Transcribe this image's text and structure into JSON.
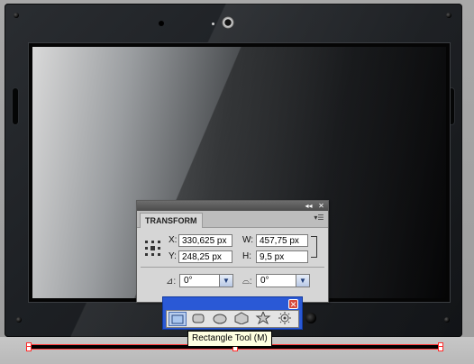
{
  "transform_panel": {
    "tab_label": "TRANSFORM",
    "x_label": "X:",
    "x_value": "330,625 px",
    "y_label": "Y:",
    "y_value": "248,25 px",
    "w_label": "W:",
    "w_value": "457,75 px",
    "h_label": "H:",
    "h_value": "9,5 px",
    "rotate_value": "0°",
    "shear_value": "0°"
  },
  "tool_flyout": {
    "tools": [
      "rectangle-tool",
      "rounded-rectangle-tool",
      "ellipse-tool",
      "polygon-tool",
      "star-tool",
      "flare-tool"
    ],
    "tooltip": "Rectangle Tool (M)"
  },
  "colors": {
    "flyout_blue": "#2a59d6",
    "selection_red": "#ff2a2a"
  }
}
